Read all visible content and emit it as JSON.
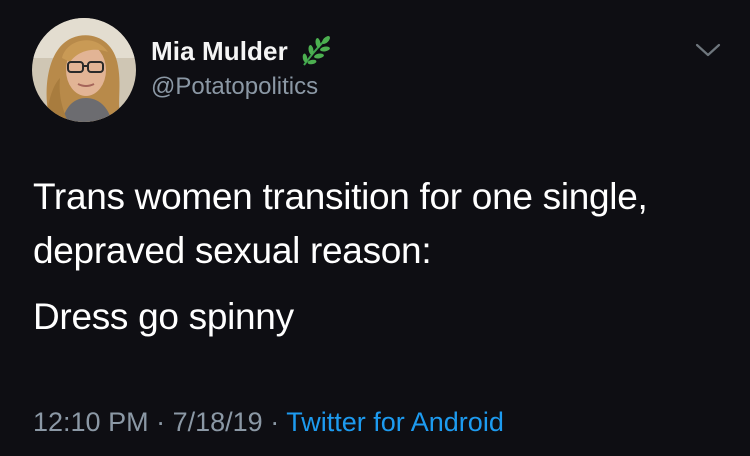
{
  "tweet": {
    "author": {
      "display_name": "Mia Mulder",
      "handle": "@Potatopolitics",
      "badge_icon": "leaf-icon"
    },
    "text_lines": [
      "Trans women transition for one single,",
      "depraved sexual reason:"
    ],
    "text_second_paragraph": "Dress go spinny",
    "timestamp": "12:10 PM",
    "date": "7/18/19",
    "separator": "·",
    "source": "Twitter for Android"
  },
  "colors": {
    "background": "#0e0e13",
    "text": "#ffffff",
    "muted": "#8b98a5",
    "link": "#1d9bf0",
    "leaf": "#3fa34d"
  }
}
